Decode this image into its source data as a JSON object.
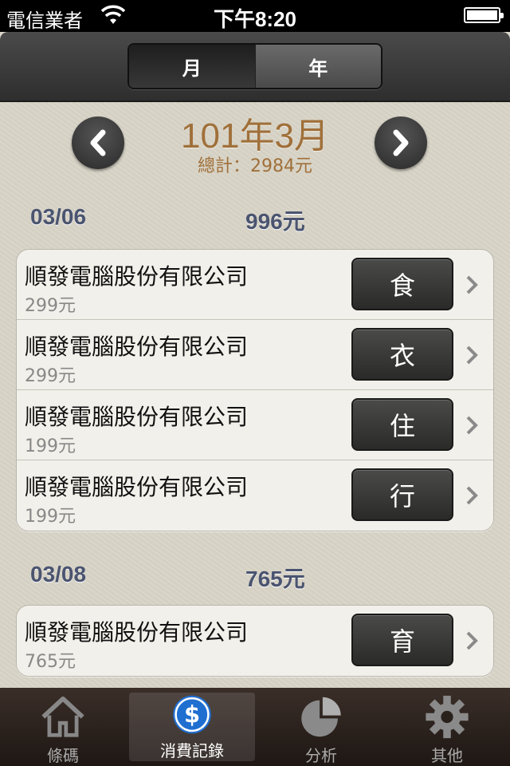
{
  "status_bar": {
    "carrier": "電信業者",
    "time": "下午8:20"
  },
  "segmented": {
    "month": "月",
    "year": "年",
    "selected": "month"
  },
  "period": {
    "title": "101年3月",
    "total": "總計：2984元"
  },
  "groups": [
    {
      "date": "03/06",
      "sum": "996元",
      "items": [
        {
          "merchant": "順發電腦股份有限公司",
          "amount": "299元",
          "category": "食"
        },
        {
          "merchant": "順發電腦股份有限公司",
          "amount": "299元",
          "category": "衣"
        },
        {
          "merchant": "順發電腦股份有限公司",
          "amount": "199元",
          "category": "住"
        },
        {
          "merchant": "順發電腦股份有限公司",
          "amount": "199元",
          "category": "行"
        }
      ]
    },
    {
      "date": "03/08",
      "sum": "765元",
      "items": [
        {
          "merchant": "順發電腦股份有限公司",
          "amount": "765元",
          "category": "育"
        }
      ]
    }
  ],
  "tabs": [
    {
      "label": "條碼",
      "icon": "house-icon"
    },
    {
      "label": "消費記錄",
      "icon": "dollar-coin-icon",
      "active": true
    },
    {
      "label": "分析",
      "icon": "pie-chart-icon"
    },
    {
      "label": "其他",
      "icon": "gear-icon"
    }
  ],
  "colors": {
    "accent": "#a0703a",
    "day_header": "#4a5470"
  }
}
